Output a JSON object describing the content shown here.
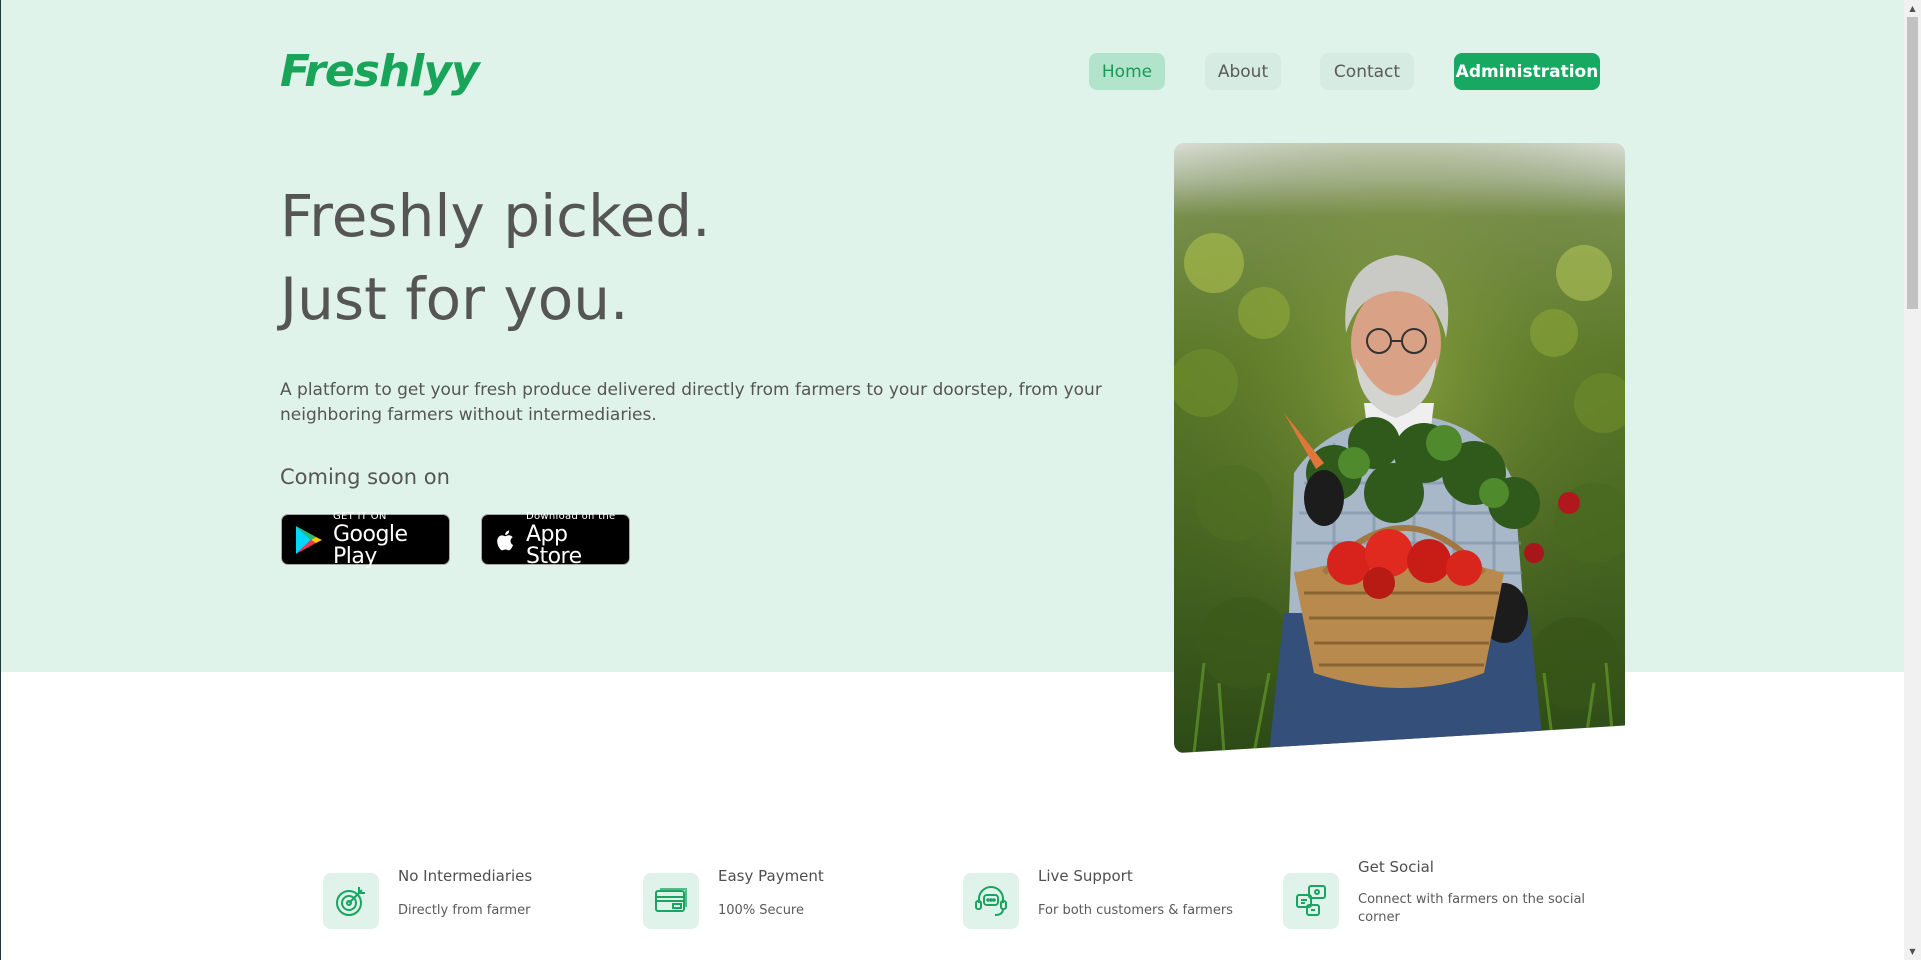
{
  "brand": {
    "name": "Freshlyy",
    "color": "#18a55a"
  },
  "nav": {
    "home": "Home",
    "about": "About",
    "contact": "Contact",
    "admin": "Administration"
  },
  "hero": {
    "title_line1": "Freshly picked.",
    "title_line2": "Just for you.",
    "description": "A platform to get your fresh produce delivered directly from farmers to your doorstep, from your neighboring farmers without intermediaries.",
    "coming_soon": "Coming soon on",
    "google_play": {
      "small": "GET IT ON",
      "big": "Google Play"
    },
    "app_store": {
      "small": "Download on the",
      "big": "App Store"
    },
    "image_alt": "Farmer holding a basket of fresh vegetables"
  },
  "features": [
    {
      "icon": "target-icon",
      "title": "No Intermediaries",
      "subtitle": "Directly from farmer"
    },
    {
      "icon": "credit-card-icon",
      "title": "Easy Payment",
      "subtitle": "100% Secure"
    },
    {
      "icon": "headset-chat-icon",
      "title": "Live Support",
      "subtitle": "For both customers & farmers"
    },
    {
      "icon": "social-icon",
      "title": "Get Social",
      "subtitle": "Connect with farmers on the social corner"
    }
  ],
  "colors": {
    "hero_bg": "#e0f3ea",
    "accent": "#17a862",
    "text": "#555555"
  }
}
